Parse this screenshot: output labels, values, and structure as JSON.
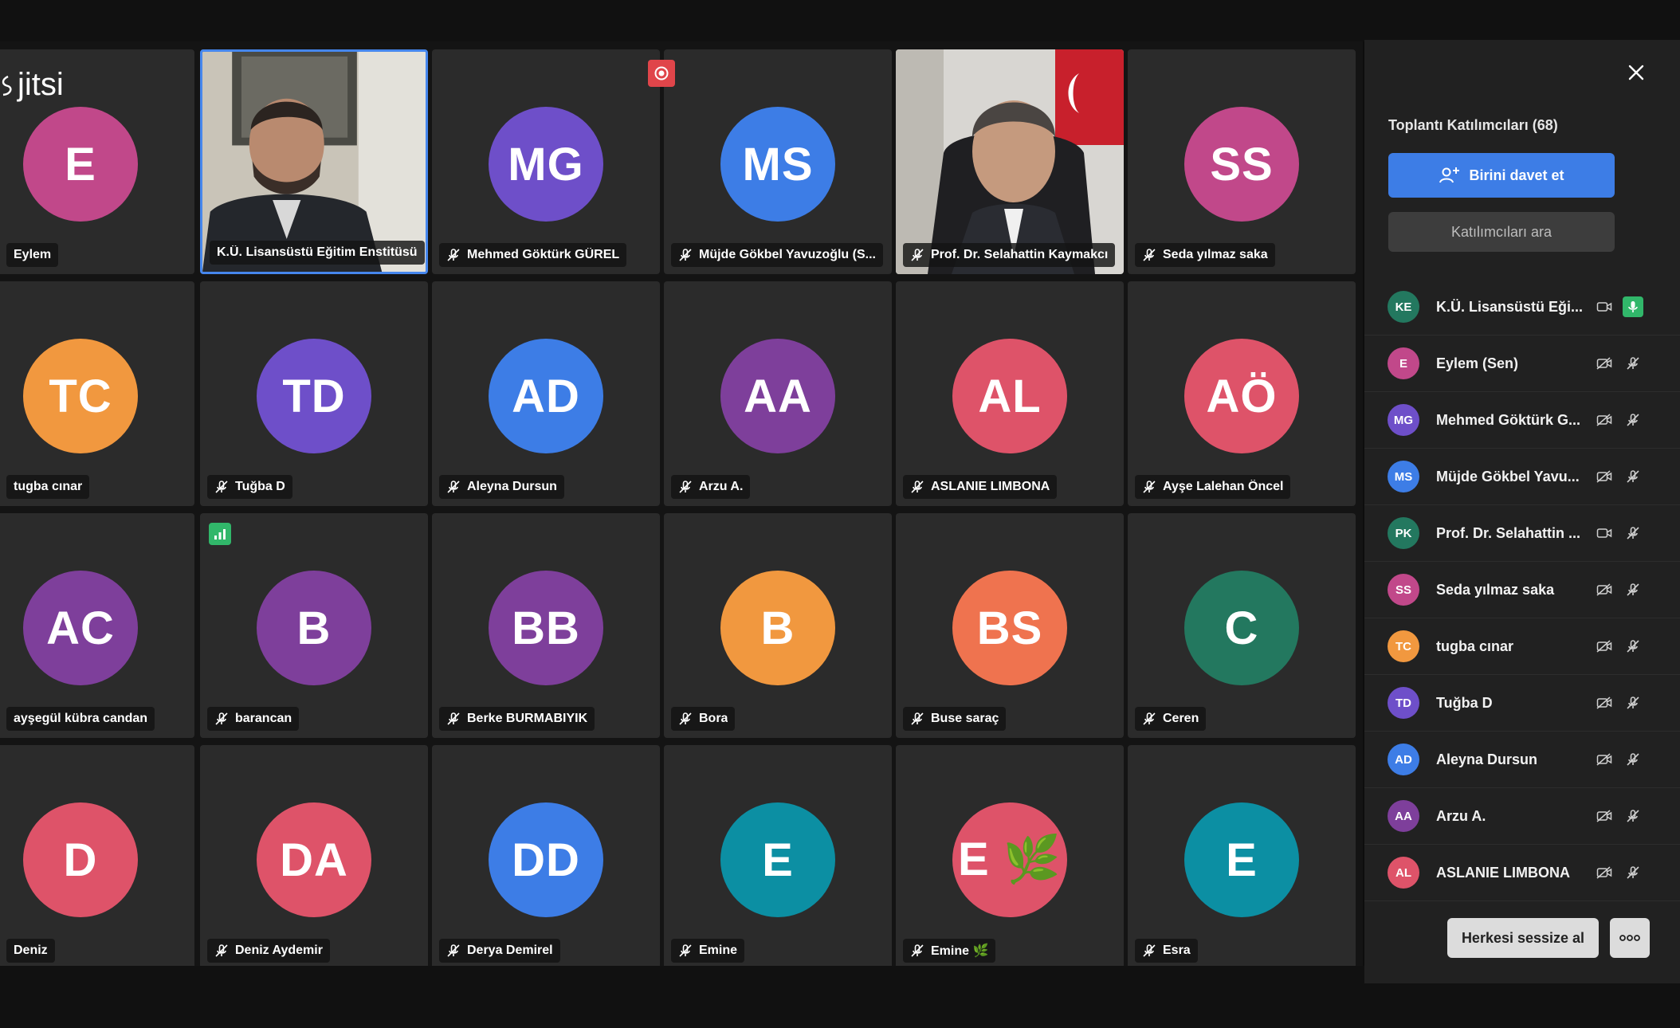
{
  "app": {
    "logo": "jitsi"
  },
  "tiles": [
    {
      "name": "Eylem",
      "initials": "E",
      "color": "#c1488a",
      "muted": false
    },
    {
      "name": "K.Ü. Lisansüstü Eğitim Enstitüsü",
      "initials": "",
      "video": true,
      "active": true,
      "muted": false
    },
    {
      "name": "Mehmed Göktürk GÜREL",
      "initials": "MG",
      "color": "#6e4fc9",
      "muted": true
    },
    {
      "name": "Müjde Gökbel Yavuzoğlu (S...",
      "initials": "MS",
      "color": "#3d7de6",
      "muted": true
    },
    {
      "name": "Prof. Dr. Selahattin Kaymakcı",
      "initials": "",
      "video": true,
      "muted": true
    },
    {
      "name": "Seda yılmaz saka",
      "initials": "SS",
      "color": "#c1488a",
      "muted": true
    },
    {
      "name": "tugba cınar",
      "initials": "TC",
      "color": "#f1983f",
      "muted": false
    },
    {
      "name": "Tuğba D",
      "initials": "TD",
      "color": "#6e4fc9",
      "muted": true
    },
    {
      "name": "Aleyna Dursun",
      "initials": "AD",
      "color": "#3d7de6",
      "muted": true
    },
    {
      "name": "Arzu A.",
      "initials": "AA",
      "color": "#7e3f9b",
      "muted": true
    },
    {
      "name": "ASLANIE LIMBONA",
      "initials": "AL",
      "color": "#de5369",
      "muted": true
    },
    {
      "name": "Ayşe Lalehan Öncel",
      "initials": "AÖ",
      "color": "#de5369",
      "muted": true
    },
    {
      "name": "ayşegül kübra candan",
      "initials": "AC",
      "color": "#7e3f9b",
      "muted": false
    },
    {
      "name": "barancan",
      "initials": "B",
      "color": "#7e3f9b",
      "muted": true
    },
    {
      "name": "Berke BURMABIYIK",
      "initials": "BB",
      "color": "#7e3f9b",
      "muted": true
    },
    {
      "name": "Bora",
      "initials": "B",
      "color": "#f1983f",
      "muted": true
    },
    {
      "name": "Buse saraç",
      "initials": "BS",
      "color": "#ef734f",
      "muted": true
    },
    {
      "name": "Ceren",
      "initials": "C",
      "color": "#23785f",
      "muted": true
    },
    {
      "name": "Deniz",
      "initials": "D",
      "color": "#de5369",
      "muted": false
    },
    {
      "name": "Deniz Aydemir",
      "initials": "DA",
      "color": "#de5369",
      "muted": true
    },
    {
      "name": "Derya Demirel",
      "initials": "DD",
      "color": "#3d7de6",
      "muted": true
    },
    {
      "name": "Emine",
      "initials": "E",
      "color": "#0c8fa3",
      "muted": true
    },
    {
      "name": "Emine 🌿",
      "initials": "E 🌿",
      "color": "#de5369",
      "muted": true
    },
    {
      "name": "Esra",
      "initials": "E",
      "color": "#0c8fa3",
      "muted": true
    }
  ],
  "sidebar": {
    "title": "Toplantı Katılımcıları (68)",
    "invite_label": "Birini davet et",
    "search_placeholder": "Katılımcıları ara",
    "mute_all_label": "Herkesi sessize al",
    "participants": [
      {
        "initials": "KE",
        "name": "K.Ü. Lisansüstü Eği...",
        "color": "#23785f",
        "video_on": true,
        "mic_on": true
      },
      {
        "initials": "E",
        "name": "Eylem (Sen)",
        "color": "#c1488a",
        "video_on": false,
        "mic_on": false
      },
      {
        "initials": "MG",
        "name": "Mehmed Göktürk G...",
        "color": "#6e4fc9",
        "video_on": false,
        "mic_on": false
      },
      {
        "initials": "MS",
        "name": "Müjde Gökbel Yavu...",
        "color": "#3d7de6",
        "video_on": false,
        "mic_on": false
      },
      {
        "initials": "PK",
        "name": "Prof. Dr. Selahattin ...",
        "color": "#23785f",
        "video_on": true,
        "mic_on": false
      },
      {
        "initials": "SS",
        "name": "Seda yılmaz saka",
        "color": "#c1488a",
        "video_on": false,
        "mic_on": false
      },
      {
        "initials": "TC",
        "name": "tugba cınar",
        "color": "#f1983f",
        "video_on": false,
        "mic_on": false
      },
      {
        "initials": "TD",
        "name": "Tuğba D",
        "color": "#6e4fc9",
        "video_on": false,
        "mic_on": false
      },
      {
        "initials": "AD",
        "name": "Aleyna Dursun",
        "color": "#3d7de6",
        "video_on": false,
        "mic_on": false
      },
      {
        "initials": "AA",
        "name": "Arzu A.",
        "color": "#7e3f9b",
        "video_on": false,
        "mic_on": false
      },
      {
        "initials": "AL",
        "name": "ASLANIE LIMBONA",
        "color": "#de5369",
        "video_on": false,
        "mic_on": false
      }
    ]
  }
}
